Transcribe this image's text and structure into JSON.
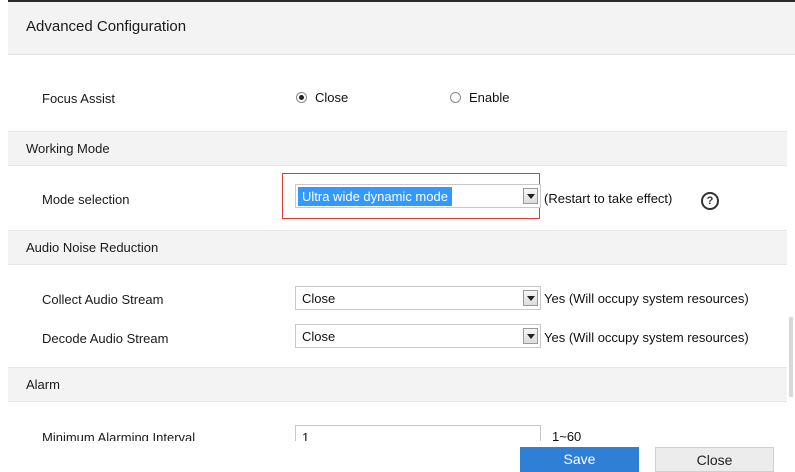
{
  "dialog": {
    "title": "Advanced Configuration"
  },
  "focus_assist": {
    "label": "Focus Assist",
    "options": [
      "Close",
      "Enable"
    ],
    "selected": "Close"
  },
  "working_mode": {
    "section_title": "Working Mode",
    "mode_label": "Mode selection",
    "mode_value": "Ultra wide dynamic mode",
    "restart_hint": "(Restart to take effect)",
    "help_glyph": "?"
  },
  "audio_noise_reduction": {
    "section_title": "Audio Noise Reduction",
    "collect_label": "Collect Audio Stream",
    "collect_value": "Close",
    "collect_hint": "Yes (Will occupy system resources)",
    "decode_label": "Decode Audio Stream",
    "decode_value": "Close",
    "decode_hint": "Yes (Will occupy system resources)"
  },
  "alarm": {
    "section_title": "Alarm",
    "interval_label": "Minimum Alarming Interval",
    "interval_value": "1",
    "interval_range": "1~60"
  },
  "footer": {
    "save_label": "Save",
    "close_label": "Close"
  },
  "colors": {
    "primary_button": "#2f7fd6",
    "selection_highlight": "#3399ff",
    "focus_outline": "#e23b3b",
    "section_background": "#f3f3f3"
  },
  "icons": {
    "help": "help-circle-icon",
    "dropdown": "chevron-down-icon"
  }
}
